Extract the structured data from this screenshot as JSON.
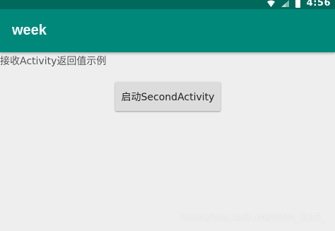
{
  "status_bar": {
    "time": "4:56",
    "icons": [
      "wifi-icon",
      "signal-icon",
      "battery-icon"
    ]
  },
  "app_bar": {
    "title": "week"
  },
  "main": {
    "description": "接收Activity返回值示例",
    "button_label": "启动SecondActivity"
  },
  "watermark": {
    "text": "https://blog.csdn.net/white_BLUE_"
  },
  "colors": {
    "status_bar": "#00695c",
    "app_bar": "#00897b",
    "background": "#eeeeee",
    "button": "#dcdcdc"
  }
}
